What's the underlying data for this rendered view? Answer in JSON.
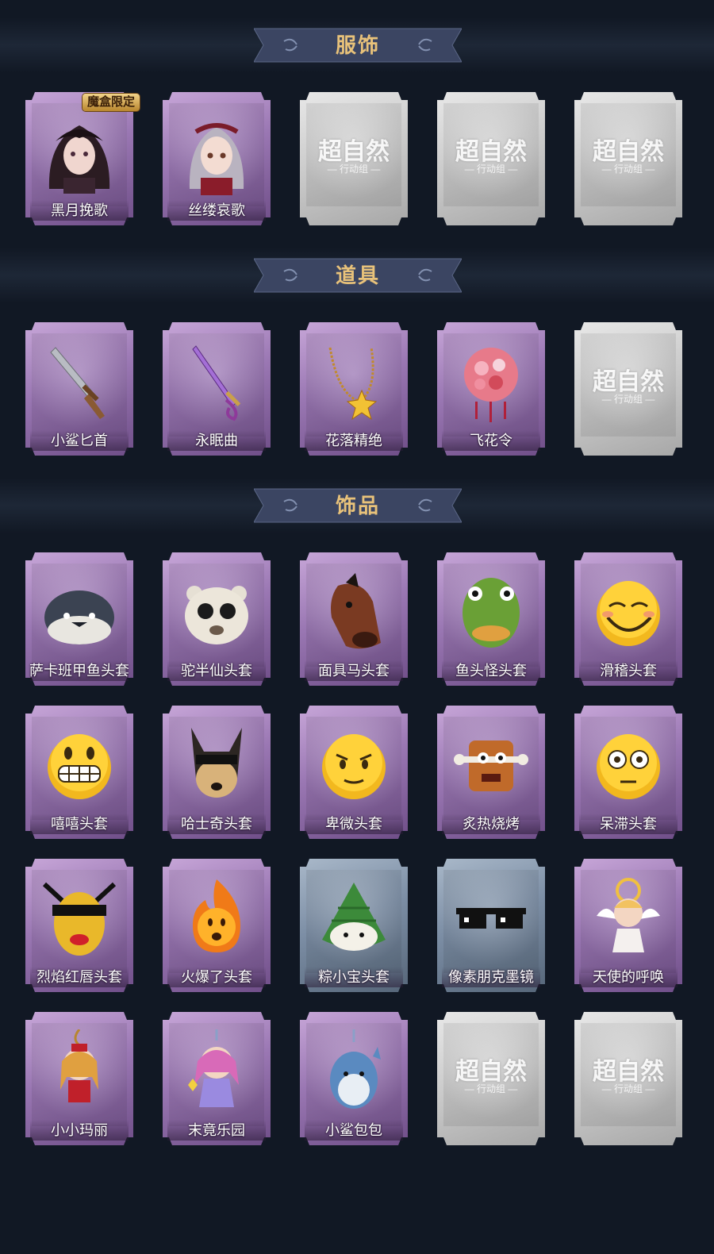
{
  "sections": [
    {
      "title": "服饰",
      "items": [
        {
          "label": "黑月挽歌",
          "style": "purple",
          "icon": "dark-lady-portrait",
          "badge": "魔盒限定"
        },
        {
          "label": "丝缕哀歌",
          "style": "purple",
          "icon": "red-lady-portrait"
        },
        {
          "label": "",
          "style": "empty",
          "icon": "placeholder-logo",
          "watermark": "超自然",
          "watermark_sub": "行动组"
        },
        {
          "label": "",
          "style": "empty",
          "icon": "placeholder-logo",
          "watermark": "超自然",
          "watermark_sub": "行动组"
        },
        {
          "label": "",
          "style": "empty",
          "icon": "placeholder-logo",
          "watermark": "超自然",
          "watermark_sub": "行动组"
        }
      ]
    },
    {
      "title": "道具",
      "items": [
        {
          "label": "小鲨匕首",
          "style": "purple",
          "icon": "shark-dagger"
        },
        {
          "label": "永眠曲",
          "style": "purple",
          "icon": "purple-sword"
        },
        {
          "label": "花落精绝",
          "style": "purple",
          "icon": "flower-necklace"
        },
        {
          "label": "飞花令",
          "style": "purple",
          "icon": "flower-ball"
        },
        {
          "label": "",
          "style": "empty",
          "icon": "placeholder-logo",
          "watermark": "超自然",
          "watermark_sub": "行动组"
        }
      ]
    },
    {
      "title": "饰品",
      "items": [
        {
          "label": "萨卡班甲鱼头套",
          "style": "purple",
          "icon": "fish-head"
        },
        {
          "label": "驼半仙头套",
          "style": "purple",
          "icon": "bear-sunglasses"
        },
        {
          "label": "面具马头套",
          "style": "purple",
          "icon": "horse-head"
        },
        {
          "label": "鱼头怪头套",
          "style": "purple",
          "icon": "green-fish-head"
        },
        {
          "label": "滑稽头套",
          "style": "purple",
          "icon": "funny-face"
        },
        {
          "label": "嘻嘻头套",
          "style": "purple",
          "icon": "grin-face"
        },
        {
          "label": "哈士奇头套",
          "style": "purple",
          "icon": "husky-sunglasses"
        },
        {
          "label": "卑微头套",
          "style": "purple",
          "icon": "humble-face"
        },
        {
          "label": "炙热烧烤",
          "style": "purple",
          "icon": "bbq-meat"
        },
        {
          "label": "呆滞头套",
          "style": "purple",
          "icon": "dazed-face"
        },
        {
          "label": "烈焰红唇头套",
          "style": "purple",
          "icon": "yellow-mask-sunglasses"
        },
        {
          "label": "火爆了头套",
          "style": "purple",
          "icon": "fire-face"
        },
        {
          "label": "粽小宝头套",
          "style": "blue",
          "icon": "zongzi-face"
        },
        {
          "label": "像素朋克墨镜",
          "style": "blue",
          "icon": "pixel-sunglasses"
        },
        {
          "label": "天使的呼唤",
          "style": "purple",
          "icon": "angel-doll"
        },
        {
          "label": "小小玛丽",
          "style": "purple",
          "icon": "mary-doll-charm"
        },
        {
          "label": "末竟乐园",
          "style": "purple",
          "icon": "fairy-doll-charm"
        },
        {
          "label": "小鲨包包",
          "style": "purple",
          "icon": "shark-bag-charm"
        },
        {
          "label": "",
          "style": "empty",
          "icon": "placeholder-logo",
          "watermark": "超自然",
          "watermark_sub": "行动组"
        },
        {
          "label": "",
          "style": "empty",
          "icon": "placeholder-logo",
          "watermark": "超自然",
          "watermark_sub": "行动组"
        }
      ]
    }
  ],
  "colors": {
    "background": "#111824",
    "banner": "#3b4562",
    "title": "#e8c27a",
    "card_purple": "#9a77b3",
    "card_blue": "#7c8ea5",
    "card_empty": "#c9c9c9"
  }
}
